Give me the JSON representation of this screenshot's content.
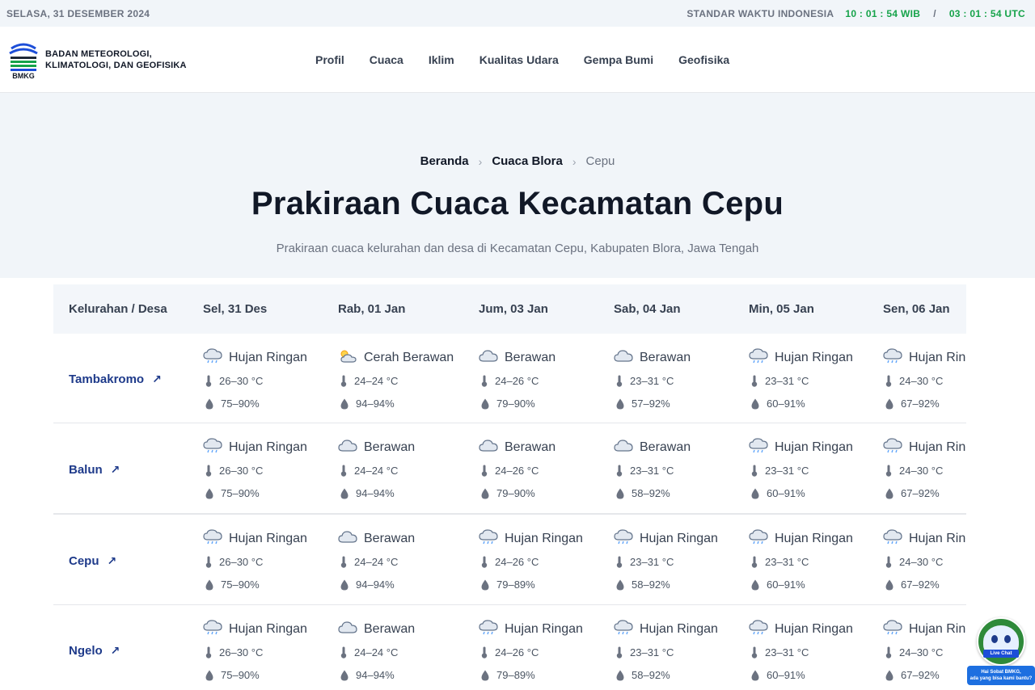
{
  "topbar": {
    "date": "SELASA, 31 DESEMBER 2024",
    "standard_label": "STANDAR WAKTU INDONESIA",
    "wib": "10 : 01 : 54 WIB",
    "separator": "/",
    "utc": "03 : 01 : 54 UTC"
  },
  "header": {
    "logo_line1": "BADAN METEOROLOGI,",
    "logo_line2": "KLIMATOLOGI, DAN GEOFISIKA",
    "logo_abbr": "BMKG",
    "nav": [
      "Profil",
      "Cuaca",
      "Iklim",
      "Kualitas Udara",
      "Gempa Bumi",
      "Geofisika"
    ]
  },
  "breadcrumb": {
    "home": "Beranda",
    "parent": "Cuaca Blora",
    "current": "Cepu"
  },
  "page": {
    "title": "Prakiraan Cuaca Kecamatan Cepu",
    "subtitle": "Prakiraan cuaca kelurahan dan desa di Kecamatan Cepu, Kabupaten Blora, Jawa Tengah"
  },
  "table": {
    "col_header": "Kelurahan / Desa",
    "days": [
      "Sel, 31 Des",
      "Rab, 01 Jan",
      "Jum, 03 Jan",
      "Sab, 04 Jan",
      "Min, 05 Jan",
      "Sen, 06 Jan"
    ],
    "rows": [
      {
        "village": "Tambakromo",
        "cells": [
          {
            "cond": "Hujan Ringan",
            "icon": "rain-cloud-icon",
            "temp": "26–30 °C",
            "hum": "75–90%"
          },
          {
            "cond": "Cerah Berawan",
            "icon": "sun-cloud-icon",
            "temp": "24–24 °C",
            "hum": "94–94%"
          },
          {
            "cond": "Berawan",
            "icon": "cloud-icon",
            "temp": "24–26 °C",
            "hum": "79–90%"
          },
          {
            "cond": "Berawan",
            "icon": "cloud-icon",
            "temp": "23–31 °C",
            "hum": "57–92%"
          },
          {
            "cond": "Hujan Ringan",
            "icon": "rain-cloud-icon",
            "temp": "23–31 °C",
            "hum": "60–91%"
          },
          {
            "cond": "Hujan Ringan",
            "icon": "rain-cloud-icon",
            "temp": "24–30 °C",
            "hum": "67–92%"
          }
        ]
      },
      {
        "village": "Balun",
        "cells": [
          {
            "cond": "Hujan Ringan",
            "icon": "rain-cloud-icon",
            "temp": "26–30 °C",
            "hum": "75–90%"
          },
          {
            "cond": "Berawan",
            "icon": "cloud-icon",
            "temp": "24–24 °C",
            "hum": "94–94%"
          },
          {
            "cond": "Berawan",
            "icon": "cloud-icon",
            "temp": "24–26 °C",
            "hum": "79–90%"
          },
          {
            "cond": "Berawan",
            "icon": "cloud-icon",
            "temp": "23–31 °C",
            "hum": "58–92%"
          },
          {
            "cond": "Hujan Ringan",
            "icon": "rain-cloud-icon",
            "temp": "23–31 °C",
            "hum": "60–91%"
          },
          {
            "cond": "Hujan Ringan",
            "icon": "rain-cloud-icon",
            "temp": "24–30 °C",
            "hum": "67–92%"
          }
        ]
      },
      {
        "village": "Cepu",
        "cells": [
          {
            "cond": "Hujan Ringan",
            "icon": "rain-cloud-icon",
            "temp": "26–30 °C",
            "hum": "75–90%"
          },
          {
            "cond": "Berawan",
            "icon": "cloud-icon",
            "temp": "24–24 °C",
            "hum": "94–94%"
          },
          {
            "cond": "Hujan Ringan",
            "icon": "rain-cloud-icon",
            "temp": "24–26 °C",
            "hum": "79–89%"
          },
          {
            "cond": "Hujan Ringan",
            "icon": "rain-cloud-icon",
            "temp": "23–31 °C",
            "hum": "58–92%"
          },
          {
            "cond": "Hujan Ringan",
            "icon": "rain-cloud-icon",
            "temp": "23–31 °C",
            "hum": "60–91%"
          },
          {
            "cond": "Hujan Ringan",
            "icon": "rain-cloud-icon",
            "temp": "24–30 °C",
            "hum": "67–92%"
          }
        ]
      },
      {
        "village": "Ngelo",
        "cells": [
          {
            "cond": "Hujan Ringan",
            "icon": "rain-cloud-icon",
            "temp": "26–30 °C",
            "hum": "75–90%"
          },
          {
            "cond": "Berawan",
            "icon": "cloud-icon",
            "temp": "24–24 °C",
            "hum": "94–94%"
          },
          {
            "cond": "Hujan Ringan",
            "icon": "rain-cloud-icon",
            "temp": "24–26 °C",
            "hum": "79–89%"
          },
          {
            "cond": "Hujan Ringan",
            "icon": "rain-cloud-icon",
            "temp": "23–31 °C",
            "hum": "58–92%"
          },
          {
            "cond": "Hujan Ringan",
            "icon": "rain-cloud-icon",
            "temp": "23–31 °C",
            "hum": "60–91%"
          },
          {
            "cond": "Hujan Ringan",
            "icon": "rain-cloud-icon",
            "temp": "24–30 °C",
            "hum": "67–92%"
          }
        ]
      }
    ]
  },
  "chat": {
    "badge_label": "Live Chat",
    "bubble_line1": "Hai Sobat BMKG,",
    "bubble_line2": "ada yang bisa kami bantu?"
  },
  "colors": {
    "accent_green": "#16a34a",
    "village_link": "#1e3a8a",
    "hero_bg": "#f1f5f9"
  }
}
